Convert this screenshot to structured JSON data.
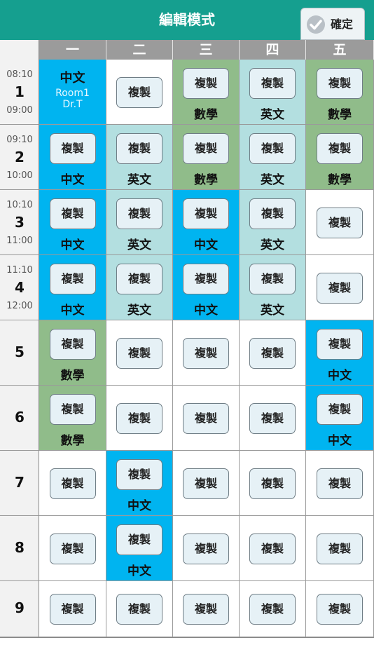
{
  "header": {
    "title": "編輯模式",
    "confirm_label": "確定"
  },
  "days": [
    "一",
    "二",
    "三",
    "四",
    "五"
  ],
  "copy_label": "複製",
  "periods": [
    {
      "num": "1",
      "start": "08:10",
      "end": "09:00"
    },
    {
      "num": "2",
      "start": "09:10",
      "end": "10:00"
    },
    {
      "num": "3",
      "start": "10:10",
      "end": "11:00"
    },
    {
      "num": "4",
      "start": "11:10",
      "end": "12:00"
    },
    {
      "num": "5",
      "start": "",
      "end": ""
    },
    {
      "num": "6",
      "start": "",
      "end": ""
    },
    {
      "num": "7",
      "start": "",
      "end": ""
    },
    {
      "num": "8",
      "start": "",
      "end": ""
    },
    {
      "num": "9",
      "start": "",
      "end": ""
    }
  ],
  "lesson_detail": {
    "subject": "中文",
    "room": "Room1",
    "teacher": "Dr.T"
  },
  "subject_colors": {
    "中文": "#00b4f0",
    "英文": "#b3dfe0",
    "數學": "#90bc8a"
  },
  "schedule": [
    [
      "detail",
      "",
      "數學",
      "英文",
      "數學"
    ],
    [
      "中文",
      "英文",
      "數學",
      "英文",
      "數學"
    ],
    [
      "中文",
      "英文",
      "中文",
      "英文",
      ""
    ],
    [
      "中文",
      "英文",
      "中文",
      "英文",
      ""
    ],
    [
      "數學",
      "",
      "",
      "",
      "中文"
    ],
    [
      "數學",
      "",
      "",
      "",
      "中文"
    ],
    [
      "",
      "中文",
      "",
      "",
      ""
    ],
    [
      "",
      "中文",
      "",
      "",
      ""
    ],
    [
      "",
      "",
      "",
      "",
      ""
    ]
  ]
}
